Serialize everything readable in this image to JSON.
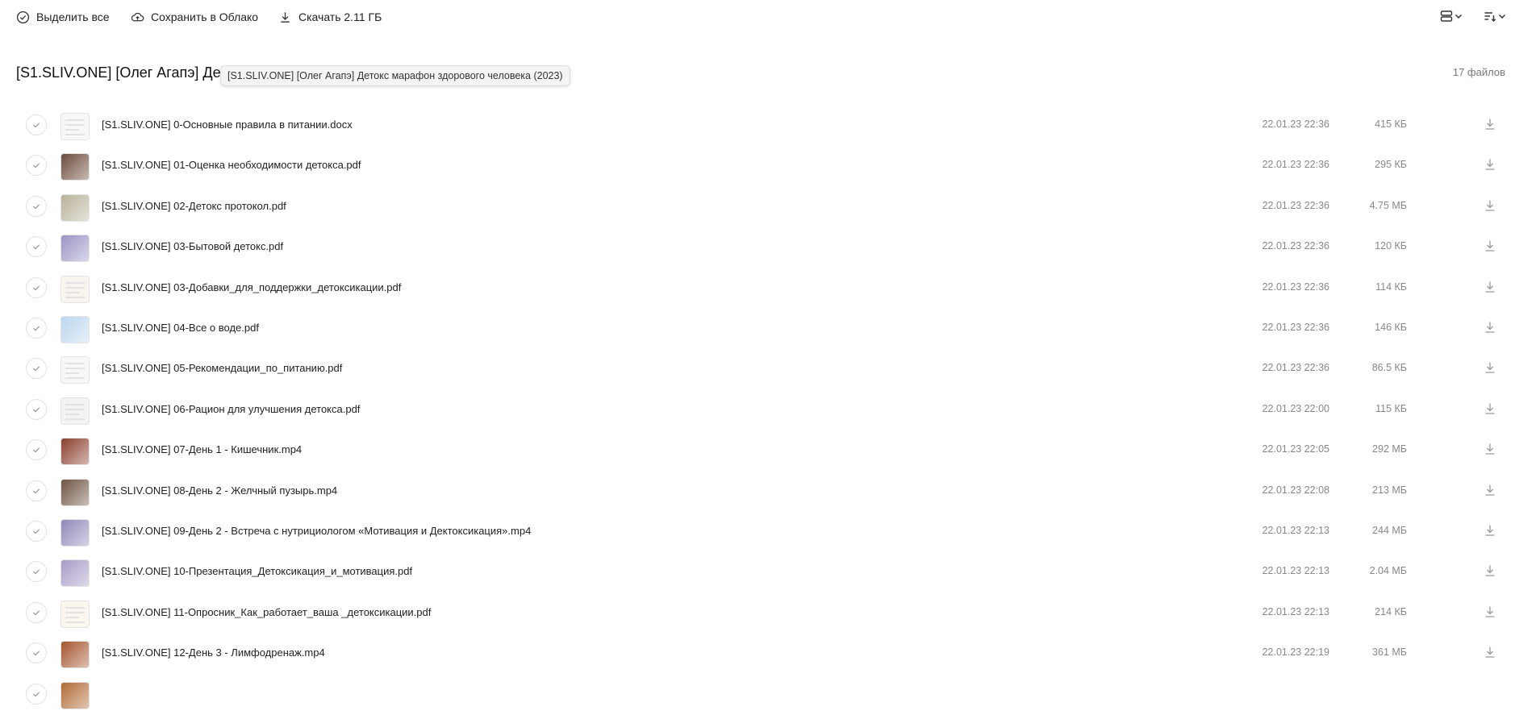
{
  "toolbar": {
    "select_all": "Выделить все",
    "save_cloud": "Сохранить в Облако",
    "download": "Скачать 2.11 ГБ"
  },
  "folder": {
    "title": "[S1.SLIV.ONE] [Олег Агапэ] Де",
    "tooltip": "[S1.SLIV.ONE] [Олег Агапэ] Детокс марафон здорового человека (2023)",
    "count": "17 файлов"
  },
  "files": [
    {
      "name": "[S1.SLIV.ONE] 0-Основные правила в питании.docx",
      "date": "22.01.23 22:36",
      "size": "415 КБ",
      "thumb": "doc",
      "color": "#f7f7f7"
    },
    {
      "name": "[S1.SLIV.ONE] 01-Оценка необходимости детокса.pdf",
      "date": "22.01.23 22:36",
      "size": "295 КБ",
      "thumb": "img",
      "color": "#6b4a3a"
    },
    {
      "name": "[S1.SLIV.ONE] 02-Детокс протокол.pdf",
      "date": "22.01.23 22:36",
      "size": "4.75 МБ",
      "thumb": "img",
      "color": "#b8b29a"
    },
    {
      "name": "[S1.SLIV.ONE] 03-Бытовой детокс.pdf",
      "date": "22.01.23 22:36",
      "size": "120 КБ",
      "thumb": "img",
      "color": "#9a94c4"
    },
    {
      "name": "[S1.SLIV.ONE] 03-Добавки_для_поддержки_детоксикации.pdf",
      "date": "22.01.23 22:36",
      "size": "114 КБ",
      "thumb": "doc",
      "color": "#f7f5ee"
    },
    {
      "name": "[S1.SLIV.ONE] 04-Все о воде.pdf",
      "date": "22.01.23 22:36",
      "size": "146 КБ",
      "thumb": "img",
      "color": "#bcd6ee"
    },
    {
      "name": "[S1.SLIV.ONE] 05-Рекомендации_по_питанию.pdf",
      "date": "22.01.23 22:36",
      "size": "86.5 КБ",
      "thumb": "doc",
      "color": "#f7f7f7"
    },
    {
      "name": "[S1.SLIV.ONE] 06-Рацион для улучшения детокса.pdf",
      "date": "22.01.23 22:00",
      "size": "115 КБ",
      "thumb": "doc",
      "color": "#f3f3f3"
    },
    {
      "name": "[S1.SLIV.ONE] 07-День 1 - Кишечник.mp4",
      "date": "22.01.23 22:05",
      "size": "292 МБ",
      "thumb": "img",
      "color": "#8a3f2c"
    },
    {
      "name": "[S1.SLIV.ONE] 08-День 2 - Желчный пузырь.mp4",
      "date": "22.01.23 22:08",
      "size": "213 МБ",
      "thumb": "img",
      "color": "#6e5442"
    },
    {
      "name": "[S1.SLIV.ONE] 09-День 2 - Встреча с нутрициологом «Мотивация и Дектоксикация».mp4",
      "date": "22.01.23 22:13",
      "size": "244 МБ",
      "thumb": "img",
      "color": "#8f88b8"
    },
    {
      "name": "[S1.SLIV.ONE] 10-Презентация_Детоксикация_и_мотивация.pdf",
      "date": "22.01.23 22:13",
      "size": "2.04 МБ",
      "thumb": "img",
      "color": "#a79bc6"
    },
    {
      "name": "[S1.SLIV.ONE] 11-Опросник_Как_работает_ваша _детоксикации.pdf",
      "date": "22.01.23 22:13",
      "size": "214 КБ",
      "thumb": "doc",
      "color": "#fbf6ee"
    },
    {
      "name": "[S1.SLIV.ONE] 12-День 3 - Лимфодренаж.mp4",
      "date": "22.01.23 22:19",
      "size": "361 МБ",
      "thumb": "img",
      "color": "#a4552e"
    },
    {
      "name": "",
      "date": "",
      "size": "",
      "thumb": "img",
      "color": "#b06a35"
    }
  ]
}
